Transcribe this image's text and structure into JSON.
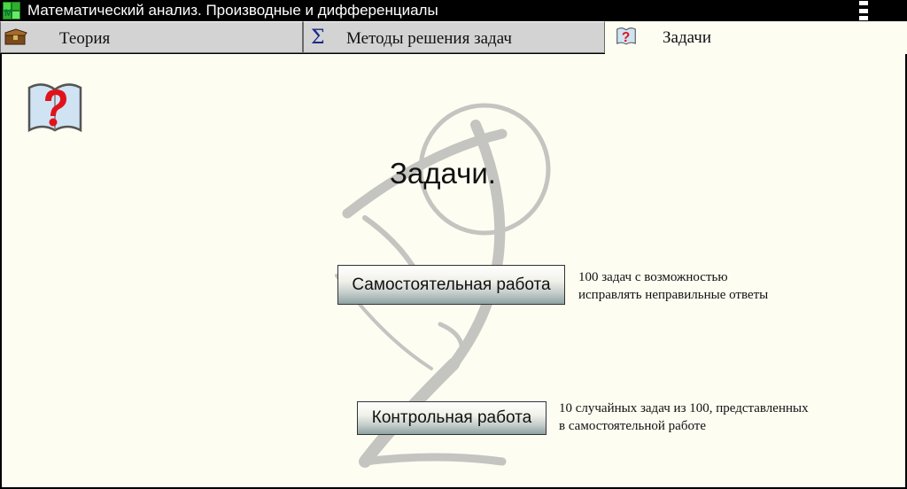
{
  "window": {
    "title": "Математический анализ. Производные и дифференциалы"
  },
  "tabs": [
    {
      "label": "Теория",
      "icon": "chest-icon",
      "active": false
    },
    {
      "label": "Методы решения задач",
      "icon": "sigma-icon",
      "active": false
    },
    {
      "label": "Задачи",
      "icon": "question-book-icon",
      "active": true
    }
  ],
  "main": {
    "heading": "Задачи.",
    "items": [
      {
        "button_label": "Самостоятельная работа",
        "desc_line1": "100 задач с возможностью",
        "desc_line2": "исправлять неправильные ответы"
      },
      {
        "button_label": "Контрольная работа",
        "desc_line1": "10 случайных задач из 100, представленных",
        "desc_line2": "в самостоятельной работе"
      }
    ]
  },
  "colors": {
    "content_bg": "#fdfdf2",
    "tab_inactive": "#d3d3d3",
    "question_red": "#e0131b",
    "book_blue": "#cfe3f3"
  }
}
